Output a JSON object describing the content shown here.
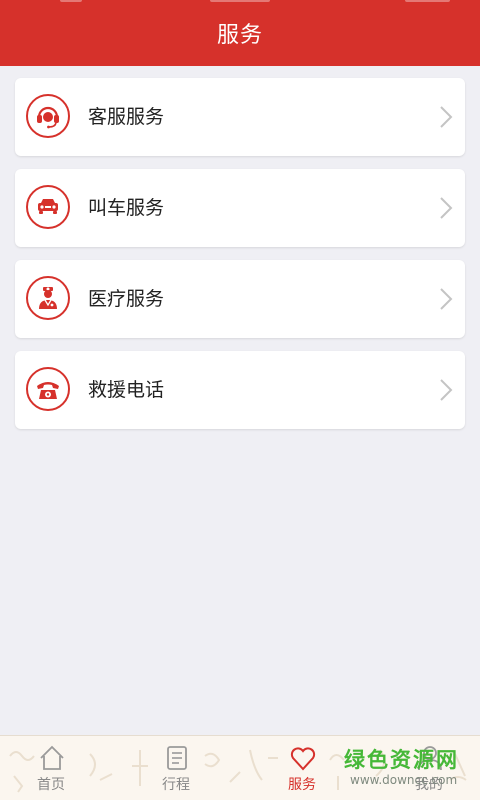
{
  "header": {
    "title": "服务"
  },
  "services": [
    {
      "label": "客服服务",
      "icon": "headset-icon"
    },
    {
      "label": "叫车服务",
      "icon": "car-icon"
    },
    {
      "label": "医疗服务",
      "icon": "doctor-icon"
    },
    {
      "label": "救援电话",
      "icon": "phone-icon"
    }
  ],
  "tabs": [
    {
      "label": "首页",
      "icon": "home-icon",
      "active": false
    },
    {
      "label": "行程",
      "icon": "itinerary-icon",
      "active": false
    },
    {
      "label": "服务",
      "icon": "heart-icon",
      "active": true
    },
    {
      "label": "我的",
      "icon": "user-icon",
      "active": false
    }
  ],
  "watermark": {
    "logo": "绿色资源网",
    "url": "www.downcc.com"
  },
  "colors": {
    "accent": "#d6312b",
    "background": "#efeff4",
    "tab_inactive": "#888888",
    "watermark_green": "#46b838"
  }
}
